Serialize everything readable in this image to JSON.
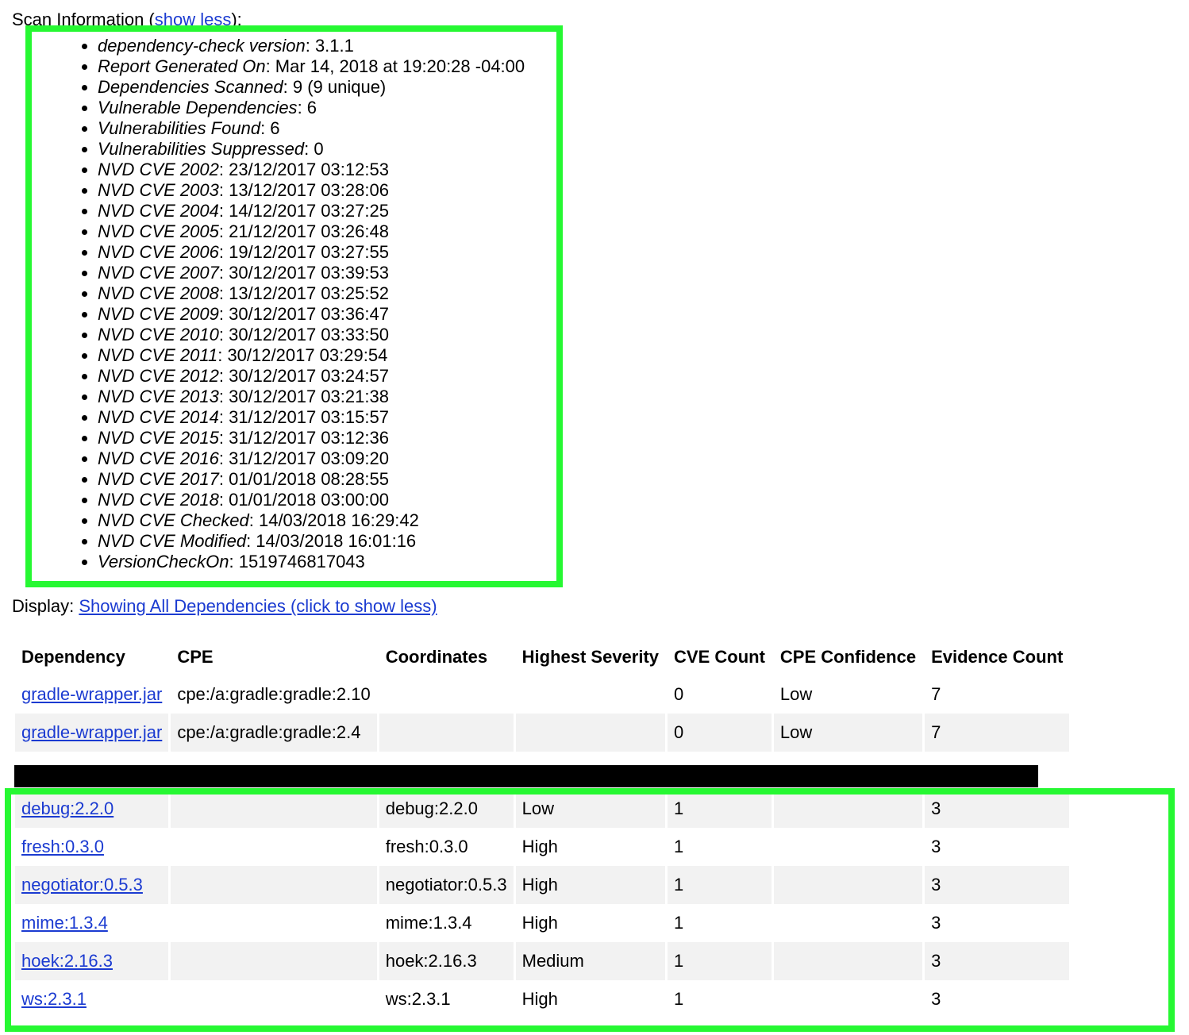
{
  "scan_info": {
    "label": "Scan Information (",
    "toggle_link": "show less",
    "label_suffix": "):",
    "items": [
      {
        "key": "dependency-check version",
        "value": ": 3.1.1"
      },
      {
        "key": "Report Generated On",
        "value": ": Mar 14, 2018 at 19:20:28 -04:00"
      },
      {
        "key": "Dependencies Scanned",
        "value": ": 9 (9 unique)"
      },
      {
        "key": "Vulnerable Dependencies",
        "value": ": 6"
      },
      {
        "key": "Vulnerabilities Found",
        "value": ": 6"
      },
      {
        "key": "Vulnerabilities Suppressed",
        "value": ": 0"
      },
      {
        "key": "NVD CVE 2002",
        "value": ": 23/12/2017 03:12:53"
      },
      {
        "key": "NVD CVE 2003",
        "value": ": 13/12/2017 03:28:06"
      },
      {
        "key": "NVD CVE 2004",
        "value": ": 14/12/2017 03:27:25"
      },
      {
        "key": "NVD CVE 2005",
        "value": ": 21/12/2017 03:26:48"
      },
      {
        "key": "NVD CVE 2006",
        "value": ": 19/12/2017 03:27:55"
      },
      {
        "key": "NVD CVE 2007",
        "value": ": 30/12/2017 03:39:53"
      },
      {
        "key": "NVD CVE 2008",
        "value": ": 13/12/2017 03:25:52"
      },
      {
        "key": "NVD CVE 2009",
        "value": ": 30/12/2017 03:36:47"
      },
      {
        "key": "NVD CVE 2010",
        "value": ": 30/12/2017 03:33:50"
      },
      {
        "key": "NVD CVE 2011",
        "value": ": 30/12/2017 03:29:54"
      },
      {
        "key": "NVD CVE 2012",
        "value": ": 30/12/2017 03:24:57"
      },
      {
        "key": "NVD CVE 2013",
        "value": ": 30/12/2017 03:21:38"
      },
      {
        "key": "NVD CVE 2014",
        "value": ": 31/12/2017 03:15:57"
      },
      {
        "key": "NVD CVE 2015",
        "value": ": 31/12/2017 03:12:36"
      },
      {
        "key": "NVD CVE 2016",
        "value": ": 31/12/2017 03:09:20"
      },
      {
        "key": "NVD CVE 2017",
        "value": ": 01/01/2018 08:28:55"
      },
      {
        "key": "NVD CVE 2018",
        "value": ": 01/01/2018 03:00:00"
      },
      {
        "key": "NVD CVE Checked",
        "value": ": 14/03/2018 16:29:42"
      },
      {
        "key": "NVD CVE Modified",
        "value": ": 14/03/2018 16:01:16"
      },
      {
        "key": "VersionCheckOn",
        "value": ": 1519746817043"
      }
    ]
  },
  "display": {
    "label": "Display: ",
    "link": "Showing All Dependencies (click to show less)"
  },
  "table": {
    "headers": [
      "Dependency",
      "CPE",
      "Coordinates",
      "Highest Severity",
      "CVE Count",
      "CPE Confidence",
      "Evidence Count"
    ],
    "rows": [
      {
        "dependency": "gradle-wrapper.jar",
        "cpe": "cpe:/a:gradle:gradle:2.10",
        "coordinates": "",
        "severity": "",
        "cve_count": "0",
        "cpe_confidence": "Low",
        "evidence_count": "7"
      },
      {
        "dependency": "gradle-wrapper.jar",
        "cpe": "cpe:/a:gradle:gradle:2.4",
        "coordinates": "",
        "severity": "",
        "cve_count": "0",
        "cpe_confidence": "Low",
        "evidence_count": "7"
      },
      {
        "dependency": "",
        "cpe": "",
        "coordinates": "",
        "severity": "",
        "cve_count": "",
        "cpe_confidence": "",
        "evidence_count": "",
        "redacted": true
      },
      {
        "dependency": "debug:2.2.0",
        "cpe": "",
        "coordinates": "debug:2.2.0",
        "severity": "Low",
        "cve_count": "1",
        "cpe_confidence": "",
        "evidence_count": "3"
      },
      {
        "dependency": "fresh:0.3.0",
        "cpe": "",
        "coordinates": "fresh:0.3.0",
        "severity": "High",
        "cve_count": "1",
        "cpe_confidence": "",
        "evidence_count": "3"
      },
      {
        "dependency": "negotiator:0.5.3",
        "cpe": "",
        "coordinates": "negotiator:0.5.3",
        "severity": "High",
        "cve_count": "1",
        "cpe_confidence": "",
        "evidence_count": "3"
      },
      {
        "dependency": "mime:1.3.4",
        "cpe": "",
        "coordinates": "mime:1.3.4",
        "severity": "High",
        "cve_count": "1",
        "cpe_confidence": "",
        "evidence_count": "3"
      },
      {
        "dependency": "hoek:2.16.3",
        "cpe": "",
        "coordinates": "hoek:2.16.3",
        "severity": "Medium",
        "cve_count": "1",
        "cpe_confidence": "",
        "evidence_count": "3"
      },
      {
        "dependency": "ws:2.3.1",
        "cpe": "",
        "coordinates": "ws:2.3.1",
        "severity": "High",
        "cve_count": "1",
        "cpe_confidence": "",
        "evidence_count": "3"
      }
    ]
  },
  "colors": {
    "highlight": "#26f832",
    "link": "#1b3bd1",
    "row_alt": "#f2f2f2",
    "redaction": "#000000"
  }
}
